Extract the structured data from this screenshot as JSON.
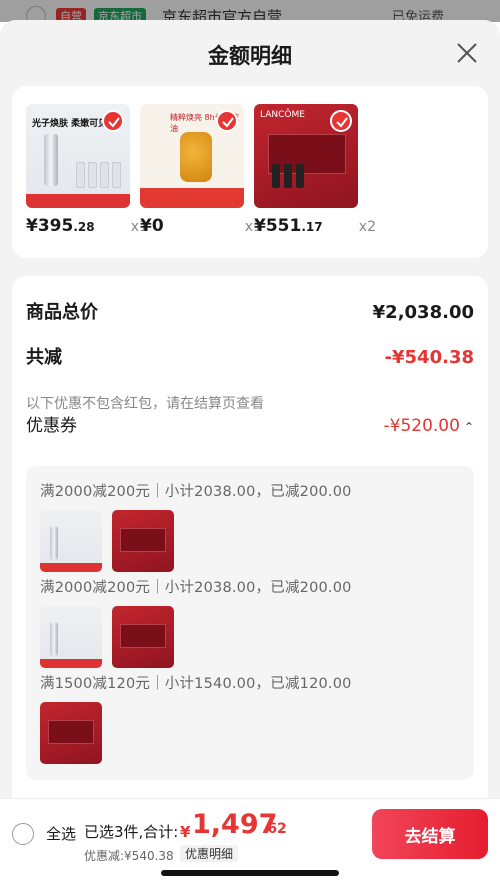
{
  "background": {
    "tag1": "自营",
    "tag2": "京东超市",
    "shop_name": "京东超市官方自营",
    "shipping": "已免运费"
  },
  "sheet": {
    "title": "金额明细"
  },
  "products": [
    {
      "price_int": "¥395",
      "price_dec": ".28",
      "qty": "x1",
      "headline": "光子焕肤 柔嫩可见"
    },
    {
      "price_int": "¥0",
      "price_dec": "",
      "qty": "x1",
      "headline": "精粹焕亮 8h长效控油"
    },
    {
      "price_int": "¥551",
      "price_dec": ".17",
      "qty": "x2",
      "headline": "LANCÔME"
    }
  ],
  "summary": {
    "total_label": "商品总价",
    "total_value": "¥2,038.00",
    "reduce_label": "共减",
    "reduce_value": "-¥540.38",
    "note": "以下优惠不包含红包，请在结算页查看",
    "coupon_label": "优惠券",
    "coupon_value": "-¥520.00"
  },
  "coupons": [
    {
      "text": "满2000减200元｜小计2038.00，已减200.00"
    },
    {
      "text": "满2000减200元｜小计2038.00，已减200.00"
    },
    {
      "text": "满1500减120元｜小计1540.00，已减120.00"
    }
  ],
  "bottom": {
    "select_all": "全选",
    "selected": "已选3件,合计:",
    "currency": "¥",
    "total_int": "1,497",
    "total_dec": ".62",
    "discount": "优惠减:¥540.38",
    "detail": "优惠明细",
    "checkout": "去结算"
  },
  "colors": {
    "accent": "#e63533",
    "sheet_bg": "#f3f3f3"
  }
}
